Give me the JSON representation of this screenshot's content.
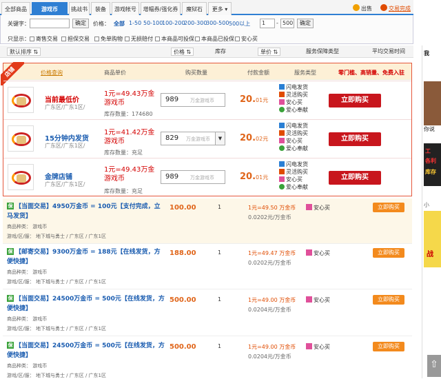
{
  "tabs": [
    {
      "label": "全部商品"
    },
    {
      "label": "游戏币"
    },
    {
      "label": "挑战书"
    },
    {
      "label": "装备"
    },
    {
      "label": "游戏帐号"
    },
    {
      "label": "增幅券/强化券"
    },
    {
      "label": "魔狱石"
    },
    {
      "label": "更多"
    }
  ],
  "top_links": {
    "sell": "出售",
    "trade_done": "交易完成"
  },
  "filter": {
    "keyword_label": "关键字：",
    "keyword_value": "",
    "confirm": "确定",
    "price_label": "价格：",
    "price_links": [
      "全部",
      "1-50",
      "50-100",
      "100-200",
      "200-300",
      "300-500",
      "500以上"
    ],
    "range_min": "1",
    "range_sep": "-",
    "range_max": "500",
    "range_confirm": "确定",
    "show_label": "只显示：",
    "checkboxes": [
      "寄售交易",
      "担保交易",
      "免单购物",
      "无损赔付",
      "本商品可投保",
      "本商品已投保",
      "安心买"
    ]
  },
  "sort": {
    "default": "默认排序",
    "price": "价格",
    "stock": "库存",
    "unit": "单价",
    "service": "服务保障类型",
    "avg_time": "平均交易时间"
  },
  "promo": {
    "ribbon": "店铺",
    "header": {
      "link": "价格查询",
      "unit_price": "商品单价",
      "qty": "购买数量",
      "pay": "付款金额",
      "service": "服务类型",
      "slogan": "零门槛、高销量、免费入驻"
    },
    "rows": [
      {
        "name": "当前最低价",
        "region": "广东区/广东1区/",
        "rate": "1元=49.43万金游戏币",
        "stock": "库存数量：174680",
        "qty": "989",
        "qty_unit": "万金游戏币",
        "price_int": "20.",
        "price_dec": "01",
        "price_unit": "元",
        "services": [
          "闪电发货",
          "灵活购买",
          "安心买",
          "爱心奉献"
        ],
        "buy": "立即购买"
      },
      {
        "name": "15分钟内发货",
        "region": "广东区/广东1区/",
        "rate": "1元=41.42万金游戏币",
        "stock": "库存数量：充足",
        "qty": "829",
        "qty_unit": "万金游戏币",
        "price_int": "20.",
        "price_dec": "02",
        "price_unit": "元",
        "services": [
          "闪电发货",
          "灵活购买",
          "安心买",
          "爱心奉献"
        ],
        "buy": "立即购买"
      },
      {
        "name": "金牌店铺",
        "region": "广东区/广东1区/",
        "rate": "1元=49.43万金游戏币",
        "stock": "库存数量：充足",
        "qty": "989",
        "qty_unit": "万金游戏币",
        "price_int": "20.",
        "price_dec": "01",
        "price_unit": "元",
        "services": [
          "闪电发货",
          "灵活购买",
          "安心买",
          "爱心奉献"
        ],
        "buy": "立即购买"
      }
    ]
  },
  "listings": [
    {
      "tag": "保",
      "title": "【当面交易】4950万金币 = 100元【支付完成，立马发货】",
      "kind": "商品种类： 游戏币",
      "region": "游戏/区/服：   地下城与勇士 / 广东区 / 广东1区",
      "price": "100.00",
      "qty": "1",
      "rate": "1元=49.50 万金币",
      "unit": "0.0202元/万金币",
      "safe": "安心买",
      "buy": "立即购买"
    },
    {
      "tag": "保",
      "title": "【邮寄交易】9300万金币 = 188元【在线发货，方便快捷】",
      "kind": "商品种类： 游戏币",
      "region": "游戏/区/服：   地下城与勇士 / 广东区 / 广东1区",
      "price": "188.00",
      "qty": "1",
      "rate": "1元=49.47 万金币",
      "unit": "0.0202元/万金币",
      "safe": "安心买",
      "buy": "立即购买"
    },
    {
      "tag": "保",
      "title": "【当面交易】24500万金币 = 500元【在线发货，方便快捷】",
      "kind": "商品种类： 游戏币",
      "region": "游戏/区/服：   地下城与勇士 / 广东区 / 广东1区",
      "price": "500.00",
      "qty": "1",
      "rate": "1元=49.00 万金币",
      "unit": "0.0204元/万金币",
      "safe": "安心买",
      "buy": "立即购买"
    },
    {
      "tag": "保",
      "title": "【当面交易】24500万金币 = 500元【在线发货，方便快捷】",
      "kind": "商品种类： 游戏币",
      "region": "游戏/区/服：   地下城与勇士 / 广东区 / 广东1区",
      "price": "500.00",
      "qty": "1",
      "rate": "1元=49.00 万金币",
      "unit": "0.0204元/万金币",
      "safe": "安心买",
      "buy": "立即购买"
    }
  ],
  "side": {
    "t1": "我",
    "t2": "你说",
    "t3": "工",
    "t4": "各利",
    "t5": "库存",
    "t6": "小",
    "t7": "战"
  },
  "colors": {
    "accent": "#2f7fd3",
    "buy_red": "#c8161d",
    "price_orange": "#e0651a",
    "buy_orange": "#f38a1d"
  }
}
